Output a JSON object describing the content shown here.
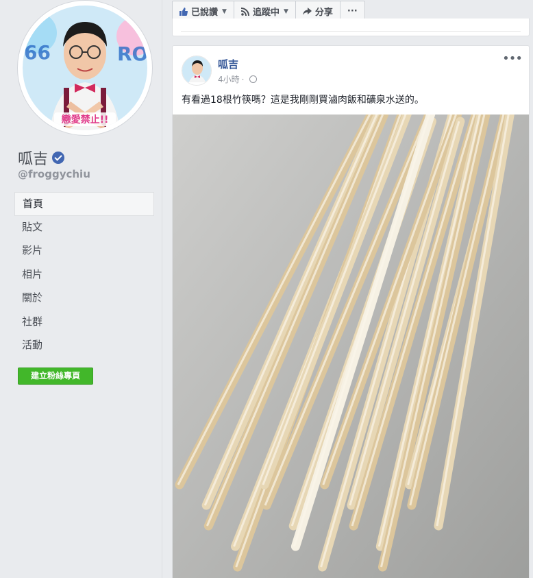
{
  "profile": {
    "name": "呱吉",
    "username": "@froggychiu",
    "picture_text": "戀愛禁止!!"
  },
  "nav": {
    "items": [
      "首頁",
      "貼文",
      "影片",
      "相片",
      "關於",
      "社群",
      "活動"
    ],
    "active_index": 0
  },
  "create_page_button": "建立粉絲專頁",
  "action_bar": {
    "liked": "已說讚",
    "following": "追蹤中",
    "share": "分享",
    "more": "···"
  },
  "post": {
    "author": "呱吉",
    "time": "4小時",
    "separator": "·",
    "text": "有看過18根竹筷嗎？這是我剛剛買滷肉飯和礦泉水送的。",
    "more": "•••",
    "photo_subject": "bamboo chopsticks",
    "chopstick_count": 18
  },
  "colors": {
    "background": "#e9ebee",
    "link": "#365899",
    "create_button": "#42b72a",
    "verified": "#4267b2",
    "chopstick": "#e4d2ad"
  }
}
